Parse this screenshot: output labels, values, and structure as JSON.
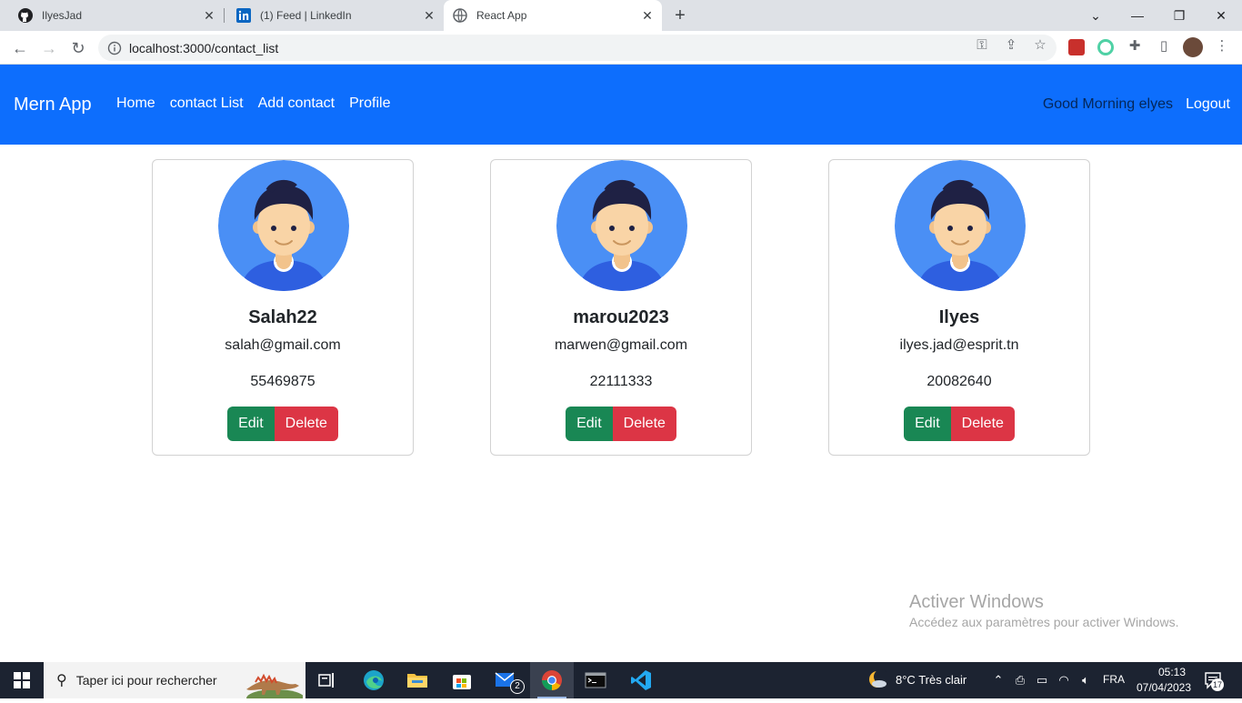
{
  "browser": {
    "tabs": [
      {
        "title": "IlyesJad",
        "icon": "github-icon"
      },
      {
        "title": "(1) Feed | LinkedIn",
        "icon": "linkedin-icon"
      },
      {
        "title": "React App",
        "icon": "globe-icon",
        "active": true
      }
    ],
    "url": "localhost:3000/contact_list"
  },
  "navbar": {
    "brand": "Mern App",
    "links": [
      "Home",
      "contact List",
      "Add contact",
      "Profile"
    ],
    "greeting": "Good Morning elyes",
    "logout": "Logout",
    "color": "#0d6efd"
  },
  "contacts": [
    {
      "name": "Salah22",
      "email": "salah@gmail.com",
      "phone": "55469875",
      "edit_label": "Edit",
      "delete_label": "Delete"
    },
    {
      "name": "marou2023",
      "email": "marwen@gmail.com",
      "phone": "22111333",
      "edit_label": "Edit",
      "delete_label": "Delete"
    },
    {
      "name": "Ilyes",
      "email": "ilyes.jad@esprit.tn",
      "phone": "20082640",
      "edit_label": "Edit",
      "delete_label": "Delete"
    }
  ],
  "watermark": {
    "title": "Activer Windows",
    "subtitle": "Accédez aux paramètres pour activer Windows."
  },
  "taskbar": {
    "search_placeholder": "Taper ici pour rechercher",
    "weather": "8°C  Très clair",
    "language": "FRA",
    "time": "05:13",
    "date": "07/04/2023",
    "mail_badge": "2",
    "notification_count": "17"
  },
  "colors": {
    "edit": "#198754",
    "delete": "#dc3545",
    "avatar_bg": "#4a8ff5"
  }
}
